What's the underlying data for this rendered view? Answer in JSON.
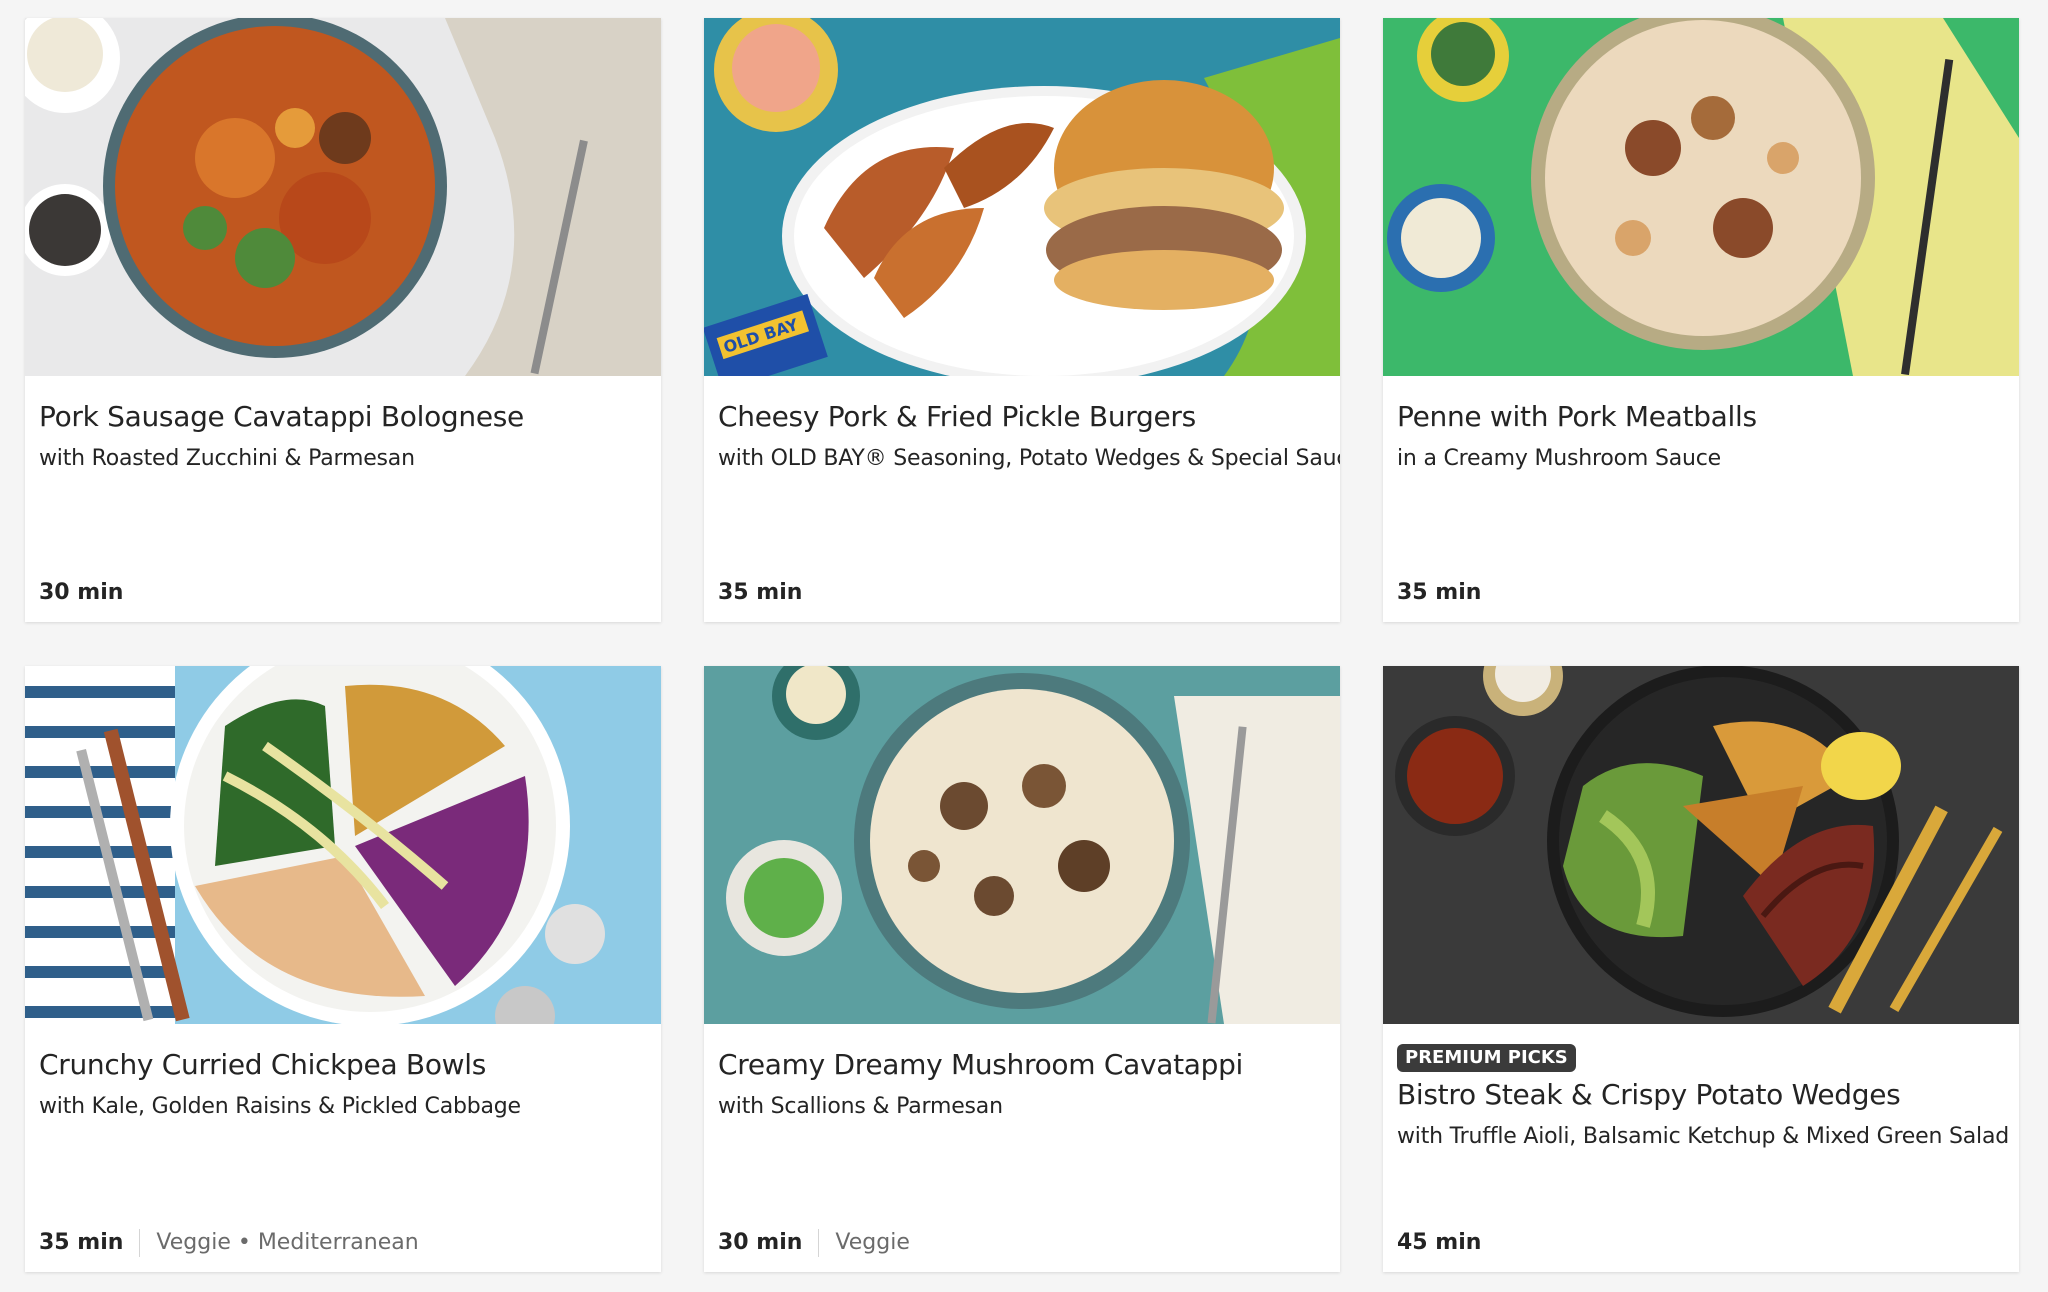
{
  "recipes": [
    {
      "title": "Pork Sausage Cavatappi Bolognese",
      "subtitle": "with Roasted Zucchini & Parmesan",
      "time": "30 min",
      "tags": "",
      "badge": ""
    },
    {
      "title": "Cheesy Pork & Fried Pickle Burgers",
      "subtitle": "with OLD BAY® Seasoning, Potato Wedges & Special Sauce",
      "time": "35 min",
      "tags": "",
      "badge": ""
    },
    {
      "title": "Penne with Pork Meatballs",
      "subtitle": "in a Creamy Mushroom Sauce",
      "time": "35 min",
      "tags": "",
      "badge": ""
    },
    {
      "title": "Crunchy Curried Chickpea Bowls",
      "subtitle": "with Kale, Golden Raisins & Pickled Cabbage",
      "time": "35 min",
      "tags": "Veggie • Mediterranean",
      "badge": ""
    },
    {
      "title": "Creamy Dreamy Mushroom Cavatappi",
      "subtitle": "with Scallions & Parmesan",
      "time": "30 min",
      "tags": "Veggie",
      "badge": ""
    },
    {
      "title": "Bistro Steak & Crispy Potato Wedges",
      "subtitle": "with Truffle Aioli, Balsamic Ketchup & Mixed Green Salad",
      "time": "45 min",
      "tags": "",
      "badge": "PREMIUM PICKS"
    }
  ],
  "packet_text": "OLD BAY"
}
